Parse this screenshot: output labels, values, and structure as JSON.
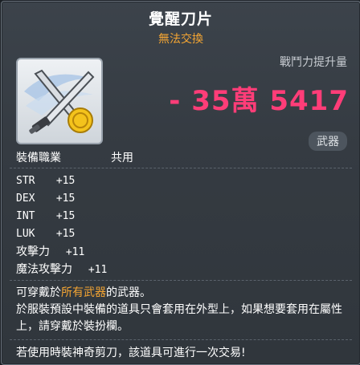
{
  "title": "覺醒刀片",
  "untradeable": "無法交換",
  "power": {
    "label": "戰鬥力提升量",
    "value": "- 35萬 5417"
  },
  "category": "武器",
  "job": {
    "label": "裝備職業",
    "value": "共用"
  },
  "stats": [
    {
      "name": "STR",
      "value": "+15"
    },
    {
      "name": "DEX",
      "value": "+15"
    },
    {
      "name": "INT",
      "value": "+15"
    },
    {
      "name": "LUK",
      "value": "+15"
    },
    {
      "name": "攻擊力",
      "value": "+11"
    },
    {
      "name": "魔法攻擊力",
      "value": "+11"
    }
  ],
  "description": {
    "line1_prefix": "可穿戴於",
    "line1_highlight": "所有武器",
    "line1_suffix": "的武器。",
    "line2": "於服裝預設中裝備的道具只會套用在外型上，如果想要套用在屬性上，請穿戴於裝扮欄。"
  },
  "trade_note": "若使用時裝神奇剪刀，該道具可進行一次交易!",
  "icon": "crossed-blades-with-gold-coin-icon",
  "colors": {
    "power": "#ff3d78",
    "untradeable": "#f4a533",
    "highlight": "#f4a533"
  }
}
